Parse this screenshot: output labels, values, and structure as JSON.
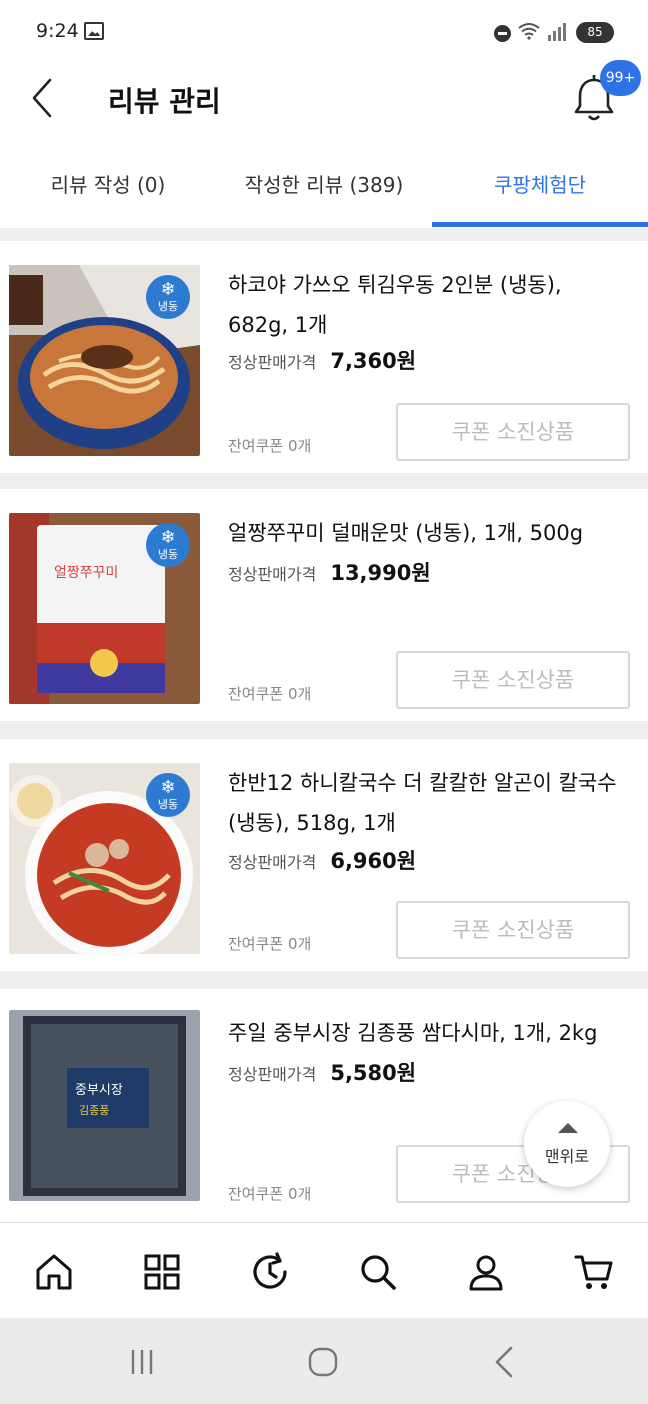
{
  "status_bar": {
    "time": "9:24",
    "battery": "85"
  },
  "header": {
    "title": "리뷰 관리",
    "notification_badge": "99+"
  },
  "tabs": [
    {
      "label": "리뷰 작성 (0)"
    },
    {
      "label": "작성한 리뷰 (389)"
    },
    {
      "label": "쿠팡체험단"
    }
  ],
  "active_tab": "쿠팡체험단",
  "products": [
    {
      "name": "하코야 가쓰오 튀김우동 2인분 (냉동), 682g, 1개",
      "price_label": "정상판매가격",
      "price": "7,360원",
      "coupon_remaining": "잔여쿠폰 0개",
      "button_label": "쿠폰 소진상품",
      "frozen_label": "냉동"
    },
    {
      "name": "얼짱쭈꾸미 덜매운맛 (냉동), 1개, 500g",
      "price_label": "정상판매가격",
      "price": "13,990원",
      "coupon_remaining": "잔여쿠폰 0개",
      "button_label": "쿠폰 소진상품",
      "frozen_label": "냉동"
    },
    {
      "name": "한반12 하니칼국수 더 칼칼한 알곤이 칼국수 (냉동), 518g, 1개",
      "price_label": "정상판매가격",
      "price": "6,960원",
      "coupon_remaining": "잔여쿠폰 0개",
      "button_label": "쿠폰 소진상품",
      "frozen_label": "냉동"
    },
    {
      "name": "주일 중부시장 김종풍 쌈다시마, 1개, 2kg",
      "price_label": "정상판매가격",
      "price": "5,580원",
      "coupon_remaining": "잔여쿠폰 0개",
      "button_label": "쿠폰 소진상품",
      "frozen_label": ""
    }
  ],
  "scroll_top_label": "맨위로",
  "bottom_nav": [
    {
      "icon": "home-icon"
    },
    {
      "icon": "category-grid-icon"
    },
    {
      "icon": "recent-history-icon"
    },
    {
      "icon": "search-icon"
    },
    {
      "icon": "my-account-icon"
    },
    {
      "icon": "cart-icon"
    }
  ],
  "colors": {
    "accent": "#2f72e5",
    "frozen_badge": "#2d7bd0",
    "disabled_text": "#bcbcbc"
  }
}
